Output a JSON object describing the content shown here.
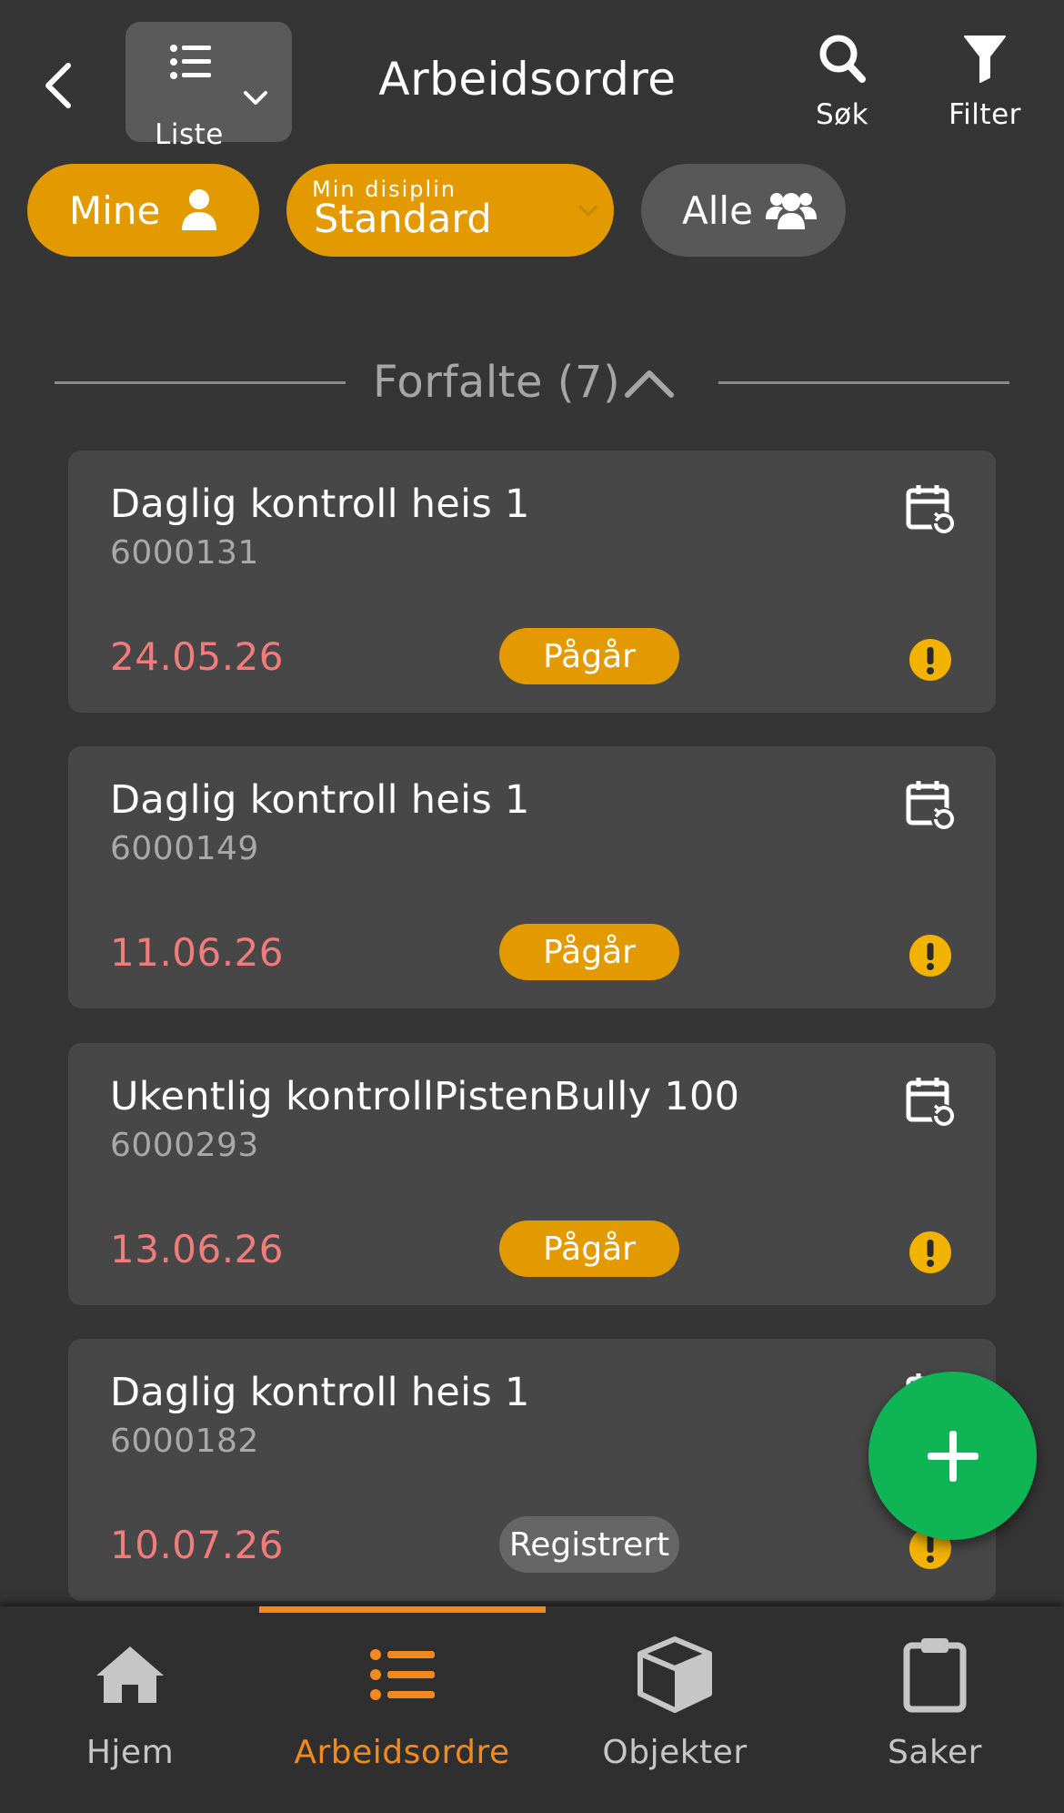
{
  "header": {
    "view_toggle_label": "Liste",
    "title": "Arbeidsordre",
    "search_label": "Søk",
    "filter_label": "Filter"
  },
  "filters": {
    "mine_label": "Mine",
    "discipline_caption": "Min disiplin",
    "discipline_value": "Standard",
    "all_label": "Alle"
  },
  "section": {
    "title": "Forfalte (7)"
  },
  "work_orders": [
    {
      "title": "Daglig kontroll heis 1",
      "number": "6000131",
      "date": "24.05.26",
      "status": "Pågår"
    },
    {
      "title": "Daglig kontroll heis 1",
      "number": "6000149",
      "date": "11.06.26",
      "status": "Pågår"
    },
    {
      "title": "Ukentlig kontrollPistenBully 100",
      "number": "6000293",
      "date": "13.06.26",
      "status": "Pågår"
    },
    {
      "title": "Daglig kontroll heis 1",
      "number": "6000182",
      "date": "10.07.26",
      "status": "Registrert"
    }
  ],
  "bottom_nav": {
    "home": "Hjem",
    "orders": "Arbeidsordre",
    "objects": "Objekter",
    "cases": "Saker"
  },
  "colors": {
    "background": "#353535",
    "card": "#474747",
    "accent_orange": "#e39a00",
    "overdue_date": "#f07c7c",
    "nav_active": "#f38a1d",
    "fab_green": "#0fb455",
    "warning_yellow": "#f2b200"
  },
  "icons": {
    "back": "chevron-left-icon",
    "view_toggle": "list-icon",
    "search": "search-icon",
    "filter": "funnel-icon",
    "mine": "user-icon",
    "all": "users-icon",
    "card_schedule": "calendar-recurring-icon",
    "card_warning": "exclamation-circle-icon",
    "fab": "plus-icon",
    "home": "home-icon",
    "orders": "list-icon",
    "objects": "cube-icon",
    "cases": "clipboard-icon"
  }
}
